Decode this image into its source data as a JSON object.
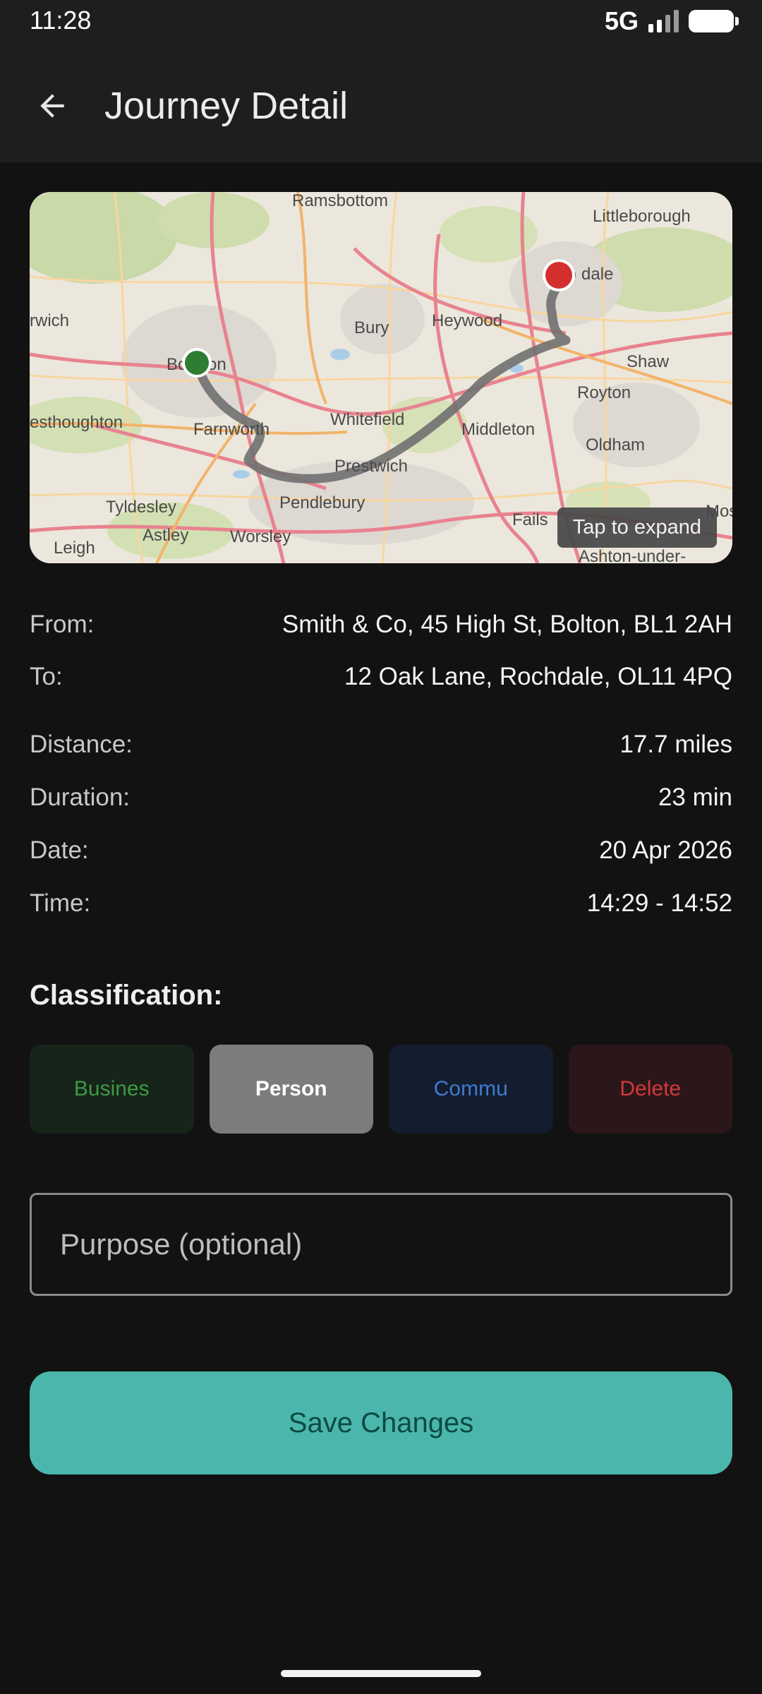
{
  "status_bar": {
    "time": "11:28",
    "network": "5G"
  },
  "app_bar": {
    "title": "Journey Detail",
    "back_icon": "arrow-back-icon"
  },
  "map": {
    "expand_label": "Tap to expand",
    "place_labels": {
      "ramsbottom": "Ramsbottom",
      "littleborough": "Littleborough",
      "rochdale_left": "Ro",
      "rochdale_right": "dale",
      "bolton_left": "Bo",
      "bolton_right": "on",
      "bury": "Bury",
      "heywood": "Heywood",
      "shaw": "Shaw",
      "royton": "Royton",
      "whitefield": "Whitefield",
      "farnworth": "Farnworth",
      "middleton": "Middleton",
      "oldham": "Oldham",
      "westhoughton": "esthoughton",
      "prestwich": "Prestwich",
      "tyldesley": "Tyldesley",
      "pendlebury": "Pendlebury",
      "astley": "Astley",
      "worsley": "Worsley",
      "leigh": "Leigh",
      "failsworth": "Fails",
      "ashton": "Ashton-under-",
      "horwich": "rwich",
      "moss": "Moss"
    },
    "start_color": "#2e7d32",
    "end_color": "#d32f2f",
    "route_color": "#707070"
  },
  "details": {
    "from_label": "From:",
    "from_value": "Smith & Co, 45 High St, Bolton, BL1 2AH",
    "to_label": "To:",
    "to_value": "12 Oak Lane, Rochdale, OL11 4PQ",
    "distance_label": "Distance:",
    "distance_value": "17.7 miles",
    "duration_label": "Duration:",
    "duration_value": "23 min",
    "date_label": "Date:",
    "date_value": "20 Apr 2026",
    "time_label": "Time:",
    "time_value": "14:29 - 14:52"
  },
  "classification": {
    "title": "Classification:",
    "buttons": [
      {
        "label": "Busines",
        "state": "unselected",
        "color": "#3d9a45"
      },
      {
        "label": "Person",
        "state": "selected",
        "color": "#ffffff"
      },
      {
        "label": "Commu",
        "state": "unselected",
        "color": "#3f7bd1"
      },
      {
        "label": "Delete",
        "state": "unselected",
        "color": "#d2393b"
      }
    ]
  },
  "purpose": {
    "placeholder": "Purpose (optional)",
    "value": ""
  },
  "save_label": "Save Changes",
  "accent_color": "#4bb7ac"
}
